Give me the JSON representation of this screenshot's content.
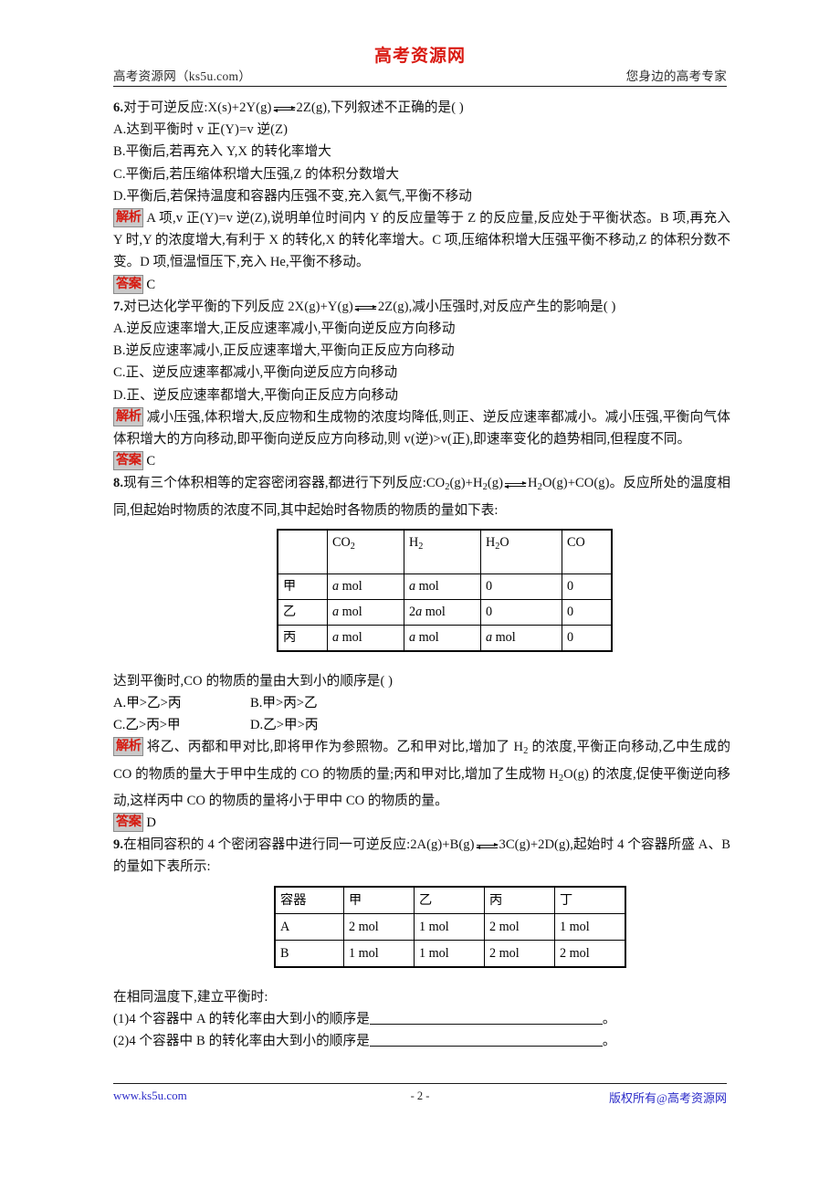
{
  "header": {
    "left": "高考资源网（ks5u.com）",
    "brand": "高考资源网",
    "right": "您身边的高考专家"
  },
  "labels": {
    "analysis": "解析",
    "answer": "答案"
  },
  "questions": [
    {
      "number": "6.",
      "stem_pre": "对于可逆反应:X(s)+2Y(g)",
      "stem_post": "2Z(g),下列叙述不正确的是(    )",
      "options": [
        "A.达到平衡时 v 正(Y)=v 逆(Z)",
        "B.平衡后,若再充入 Y,X 的转化率增大",
        "C.平衡后,若压缩体积增大压强,Z 的体积分数增大",
        "D.平衡后,若保持温度和容器内压强不变,充入氦气,平衡不移动"
      ],
      "analysis": "A 项,v 正(Y)=v 逆(Z),说明单位时间内 Y 的反应量等于 Z 的反应量,反应处于平衡状态。B 项,再充入 Y 时,Y 的浓度增大,有利于 X 的转化,X 的转化率增大。C 项,压缩体积增大压强平衡不移动,Z 的体积分数不变。D 项,恒温恒压下,充入 He,平衡不移动。",
      "answer": "C"
    },
    {
      "number": "7.",
      "stem_pre": "对已达化学平衡的下列反应 2X(g)+Y(g)",
      "stem_post": "2Z(g),减小压强时,对反应产生的影响是(    )",
      "options": [
        "A.逆反应速率增大,正反应速率减小,平衡向逆反应方向移动",
        "B.逆反应速率减小,正反应速率增大,平衡向正反应方向移动",
        "C.正、逆反应速率都减小,平衡向逆反应方向移动",
        "D.正、逆反应速率都增大,平衡向正反应方向移动"
      ],
      "analysis": "减小压强,体积增大,反应物和生成物的浓度均降低,则正、逆反应速率都减小。减小压强,平衡向气体体积增大的方向移动,即平衡向逆反应方向移动,则 v(逆)>v(正),即速率变化的趋势相同,但程度不同。",
      "answer": "C"
    },
    {
      "number": "8.",
      "stem_pre": "现有三个体积相等的定容密闭容器,都进行下列反应:CO2(g)+H2(g)",
      "stem_post": "H2O(g)+CO(g)。反应所处的温度相同,但起始时物质的浓度不同,其中起始时各物质的物质的量如下表:",
      "table": {
        "headers": [
          "",
          "CO2",
          "H2",
          "H2O",
          "CO"
        ],
        "rows": [
          [
            "甲",
            "a mol",
            "a mol",
            "0",
            "0"
          ],
          [
            "乙",
            "a mol",
            "2a mol",
            "0",
            "0"
          ],
          [
            "丙",
            "a mol",
            "a mol",
            "a mol",
            "0"
          ]
        ]
      },
      "after_table": "达到平衡时,CO 的物质的量由大到小的顺序是(    )",
      "options_grid": [
        [
          "A.甲>乙>丙",
          "B.甲>丙>乙"
        ],
        [
          "C.乙>丙>甲",
          "D.乙>甲>丙"
        ]
      ],
      "analysis": "将乙、丙都和甲对比,即将甲作为参照物。乙和甲对比,增加了 H2 的浓度,平衡正向移动,乙中生成的 CO 的物质的量大于甲中生成的 CO 的物质的量;丙和甲对比,增加了生成物 H2O(g) 的浓度,促使平衡逆向移动,这样丙中 CO 的物质的量将小于甲中 CO 的物质的量。",
      "answer": "D"
    },
    {
      "number": "9.",
      "stem_pre": "在相同容积的 4 个密闭容器中进行同一可逆反应:2A(g)+B(g)",
      "stem_post": "3C(g)+2D(g),起始时 4 个容器所盛 A、B 的量如下表所示:",
      "table": {
        "headers": [
          "容器",
          "甲",
          "乙",
          "丙",
          "丁"
        ],
        "rows": [
          [
            "A",
            "2 mol",
            "1 mol",
            "2 mol",
            "1 mol"
          ],
          [
            "B",
            "1 mol",
            "1 mol",
            "2 mol",
            "2 mol"
          ]
        ]
      },
      "after_table": "在相同温度下,建立平衡时:",
      "blanks": [
        {
          "prefix": "(1)4 个容器中 A 的转化率由大到小的顺序是",
          "suffix": "。"
        },
        {
          "prefix": "(2)4 个容器中 B 的转化率由大到小的顺序是",
          "suffix": "。"
        }
      ]
    }
  ],
  "footer": {
    "left": "www.ks5u.com",
    "center": "- 2 -",
    "right": "版权所有@高考资源网"
  }
}
